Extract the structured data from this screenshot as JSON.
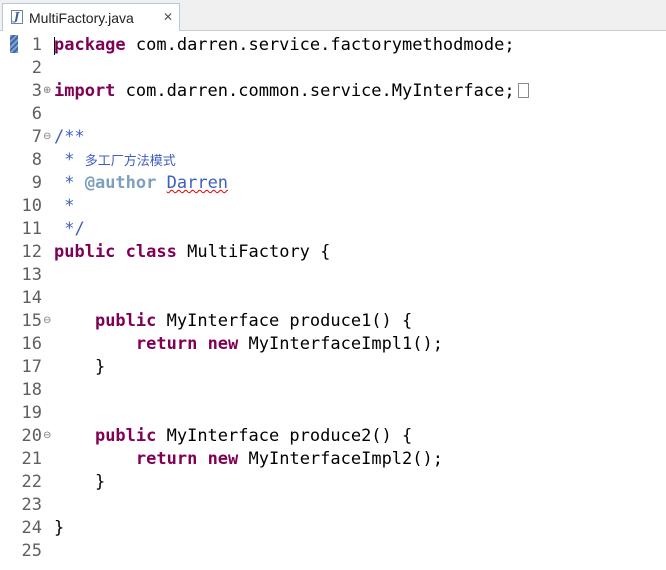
{
  "tab": {
    "title": "MultiFactory.java",
    "close_glyph": "✕",
    "icon": "java-file-icon"
  },
  "lines": [
    {
      "n": "1",
      "tokens": [
        {
          "t": "package",
          "c": "kw"
        },
        {
          "t": " com.darren.service.factorymethodmode;"
        }
      ]
    },
    {
      "n": "2",
      "tokens": []
    },
    {
      "n": "3",
      "fold": "⊕",
      "tokens": [
        {
          "t": "import",
          "c": "kw"
        },
        {
          "t": " com.darren.common.service.MyInterface;"
        },
        {
          "t": "",
          "c": "box"
        }
      ]
    },
    {
      "n": "6",
      "tokens": []
    },
    {
      "n": "7",
      "fold": "⊖",
      "tokens": [
        {
          "t": "/**",
          "c": "cm"
        }
      ]
    },
    {
      "n": "8",
      "tokens": [
        {
          "t": " * ",
          "c": "cm"
        },
        {
          "t": "多工厂方法模式",
          "c": "cm cjk cmt-small"
        }
      ]
    },
    {
      "n": "9",
      "tokens": [
        {
          "t": " * ",
          "c": "cm"
        },
        {
          "t": "@author",
          "c": "tag"
        },
        {
          "t": " ",
          "c": "cm"
        },
        {
          "t": "Darren",
          "c": "cm squig"
        }
      ]
    },
    {
      "n": "10",
      "tokens": [
        {
          "t": " *",
          "c": "cm"
        }
      ]
    },
    {
      "n": "11",
      "tokens": [
        {
          "t": " */",
          "c": "cm"
        }
      ]
    },
    {
      "n": "12",
      "tokens": [
        {
          "t": "public",
          "c": "kw"
        },
        {
          "t": " "
        },
        {
          "t": "class",
          "c": "kw"
        },
        {
          "t": " MultiFactory {"
        }
      ]
    },
    {
      "n": "13",
      "tokens": []
    },
    {
      "n": "14",
      "tokens": []
    },
    {
      "n": "15",
      "fold": "⊖",
      "tokens": [
        {
          "t": "    "
        },
        {
          "t": "public",
          "c": "kw"
        },
        {
          "t": " MyInterface produce1() {"
        }
      ]
    },
    {
      "n": "16",
      "tokens": [
        {
          "t": "        "
        },
        {
          "t": "return",
          "c": "kw"
        },
        {
          "t": " "
        },
        {
          "t": "new",
          "c": "kw"
        },
        {
          "t": " MyInterfaceImpl1();"
        }
      ]
    },
    {
      "n": "17",
      "tokens": [
        {
          "t": "    }"
        }
      ]
    },
    {
      "n": "18",
      "tokens": []
    },
    {
      "n": "19",
      "tokens": []
    },
    {
      "n": "20",
      "fold": "⊖",
      "tokens": [
        {
          "t": "    "
        },
        {
          "t": "public",
          "c": "kw"
        },
        {
          "t": " MyInterface produce2() {"
        }
      ]
    },
    {
      "n": "21",
      "tokens": [
        {
          "t": "        "
        },
        {
          "t": "return",
          "c": "kw"
        },
        {
          "t": " "
        },
        {
          "t": "new",
          "c": "kw"
        },
        {
          "t": " MyInterfaceImpl2();"
        }
      ]
    },
    {
      "n": "22",
      "tokens": [
        {
          "t": "    }"
        }
      ]
    },
    {
      "n": "23",
      "tokens": []
    },
    {
      "n": "24",
      "tokens": [
        {
          "t": "}"
        }
      ]
    },
    {
      "n": "25",
      "tokens": []
    }
  ]
}
